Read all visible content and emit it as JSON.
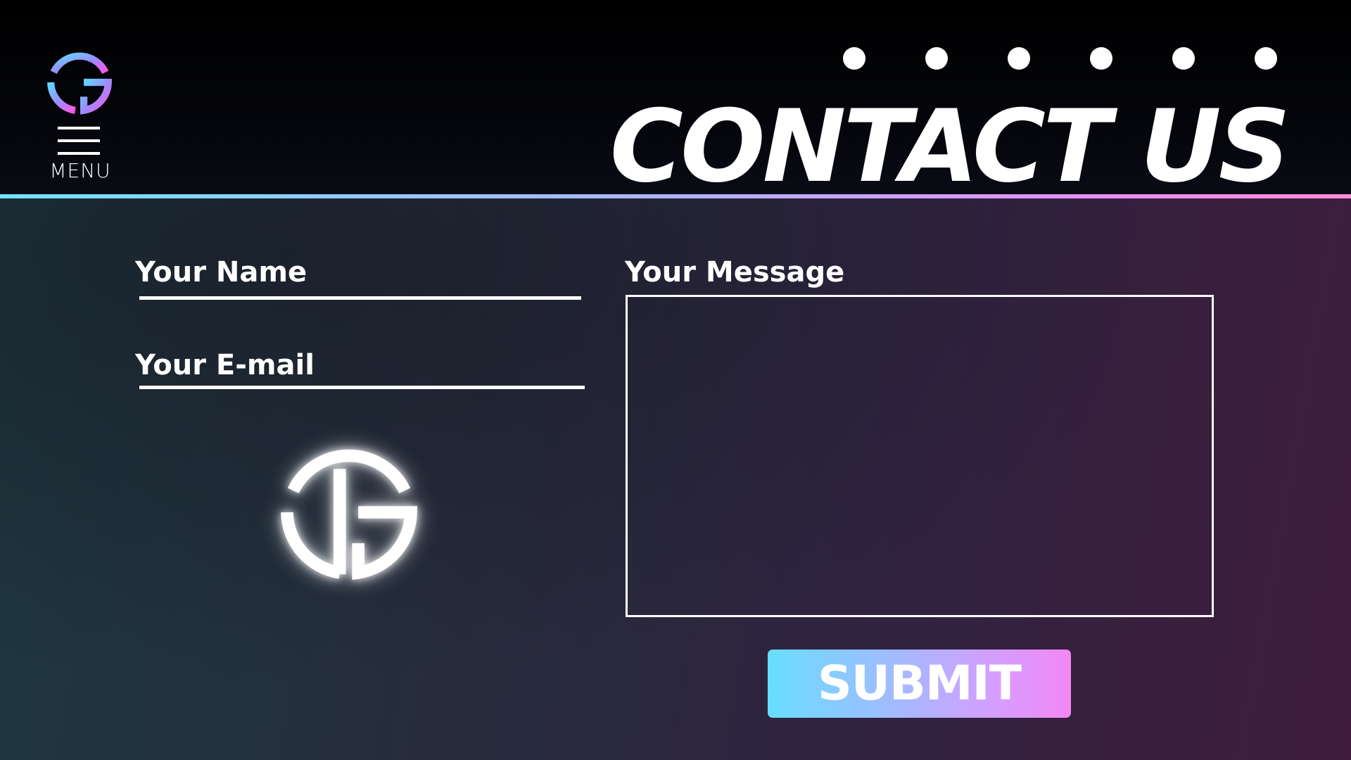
{
  "header": {
    "menu_label": "MENU",
    "title": "CONTACT US",
    "logo_icon": "jg-monogram-icon",
    "carousel_dot_count": 6
  },
  "form": {
    "name_label": "Your Name",
    "name_value": "",
    "email_label": "Your E-mail",
    "email_value": "",
    "message_label": "Your Message",
    "message_value": "",
    "submit_label": "SUBMIT"
  },
  "colors": {
    "accent_cyan": "#68deff",
    "accent_violet": "#a7b8ff",
    "accent_pink": "#f288f4",
    "background_dark": "#000000",
    "text": "#ffffff"
  }
}
